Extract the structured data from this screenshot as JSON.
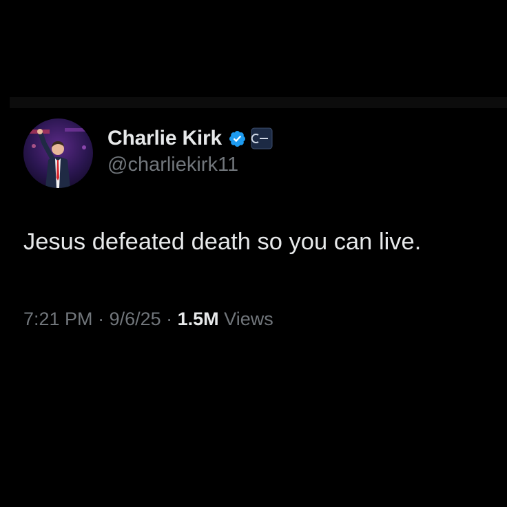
{
  "author": {
    "display_name": "Charlie Kirk",
    "handle": "@charliekirk11",
    "verified_color": "#1d9bf0"
  },
  "tweet": {
    "text": "Jesus defeated death so you can live."
  },
  "meta": {
    "time": "7:21 PM",
    "separator": " · ",
    "date": "9/6/25",
    "views_count": "1.5M",
    "views_label": " Views"
  },
  "icons": {
    "verified": "verified-check-badge",
    "affiliate": "affiliate-org-badge"
  },
  "colors": {
    "background": "#000000",
    "primary_text": "#e7e9ea",
    "secondary_text": "#71767b"
  }
}
